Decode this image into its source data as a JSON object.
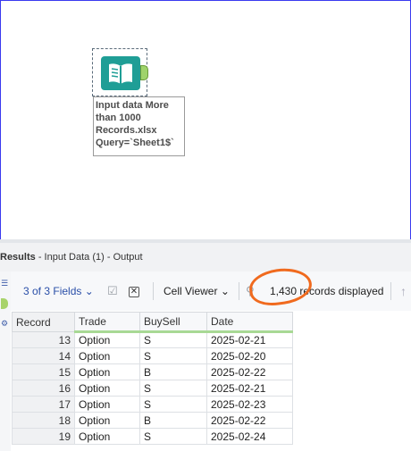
{
  "canvas": {
    "tool": {
      "icon": "book-input-icon",
      "annotation_lines": [
        "Input data More",
        "than 1000",
        "Records.xlsx",
        "Query=`Sheet1$`"
      ]
    }
  },
  "results": {
    "title": "Results",
    "subtitle": "- Input Data (1) - Output"
  },
  "toolbar": {
    "fields_label": "3 of 3 Fields",
    "viewer_label": "Cell Viewer",
    "records_label": "1,430 records displayed"
  },
  "table": {
    "columns": [
      "Record",
      "Trade",
      "BuySell",
      "Date"
    ],
    "rows": [
      [
        "13",
        "Option",
        "S",
        "2025-02-21"
      ],
      [
        "14",
        "Option",
        "S",
        "2025-02-20"
      ],
      [
        "15",
        "Option",
        "B",
        "2025-02-22"
      ],
      [
        "16",
        "Option",
        "S",
        "2025-02-21"
      ],
      [
        "17",
        "Option",
        "S",
        "2025-02-23"
      ],
      [
        "18",
        "Option",
        "B",
        "2025-02-22"
      ],
      [
        "19",
        "Option",
        "S",
        "2025-02-24"
      ]
    ]
  },
  "colors": {
    "tool_teal": "#1f9e96",
    "anchor_green": "#9fd36b",
    "highlight_orange": "#f06a1e",
    "link_blue": "#2a4fa8"
  }
}
